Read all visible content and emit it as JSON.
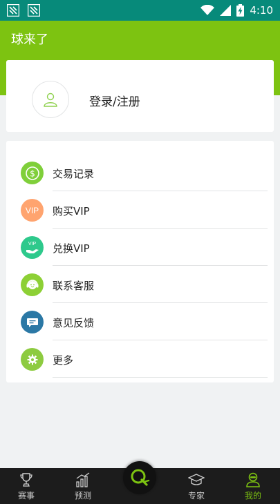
{
  "status_bar": {
    "time": "4:10",
    "notifications": [
      "notification-icon",
      "notification-icon"
    ],
    "indicators": [
      "wifi-icon",
      "signal-icon",
      "battery-charging-icon"
    ]
  },
  "header": {
    "title": "球来了"
  },
  "profile": {
    "avatar_icon": "user-icon",
    "login_label": "登录/注册"
  },
  "menu": {
    "items": [
      {
        "label": "交易记录",
        "icon": "coin-icon",
        "color": "#7fcf3a"
      },
      {
        "label": "购买VIP",
        "icon": "vip-badge-icon",
        "icon_text": "VIP",
        "color": "#ffa46f"
      },
      {
        "label": "兑换VIP",
        "icon": "vip-hand-icon",
        "icon_text": "VIP",
        "color": "#2ec98c"
      },
      {
        "label": "联系客服",
        "icon": "customer-service-icon",
        "color": "#8dd035"
      },
      {
        "label": "意见反馈",
        "icon": "feedback-icon",
        "color": "#2b78a5"
      },
      {
        "label": "更多",
        "icon": "gear-icon",
        "color": "#8dcb40"
      }
    ]
  },
  "bottom_nav": {
    "items": [
      {
        "label": "赛事",
        "icon": "trophy-icon"
      },
      {
        "label": "预测",
        "icon": "bar-chart-icon"
      },
      {
        "label": "专家",
        "icon": "graduation-cap-icon"
      },
      {
        "label": "我的",
        "icon": "profile-icon",
        "active": true
      }
    ],
    "center_icon": "app-logo-icon"
  },
  "colors": {
    "status_bar": "#078a7a",
    "brand_green": "#7dc311",
    "page_bg": "#f0f2f3",
    "nav_bg": "#1c1c1c"
  }
}
